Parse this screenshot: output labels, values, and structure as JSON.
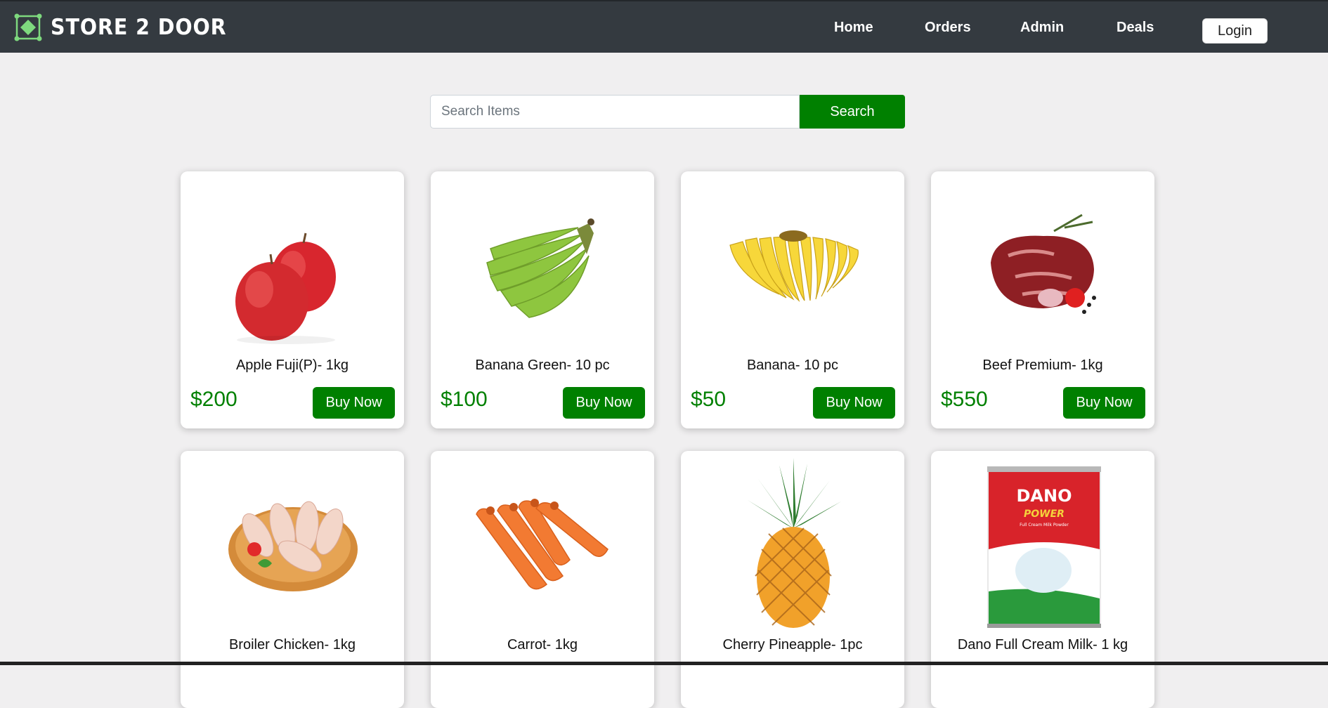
{
  "brand": {
    "name": "STORE 2 DOOR",
    "logo_icon": "diamond-logo-icon",
    "accent": "#7ed97e"
  },
  "nav": {
    "home": "Home",
    "orders": "Orders",
    "admin": "Admin",
    "deals": "Deals",
    "login": "Login"
  },
  "search": {
    "placeholder": "Search Items",
    "value": "",
    "button": "Search"
  },
  "colors": {
    "navbar": "#343a40",
    "primary": "#008000",
    "background": "#f0eff0"
  },
  "products": [
    {
      "name": "Apple Fuji(P)- 1kg",
      "price": "$200",
      "button": "Buy Now",
      "image": "apple"
    },
    {
      "name": "Banana Green- 10 pc",
      "price": "$100",
      "button": "Buy Now",
      "image": "green-banana"
    },
    {
      "name": "Banana- 10 pc",
      "price": "$50",
      "button": "Buy Now",
      "image": "banana"
    },
    {
      "name": "Beef Premium- 1kg",
      "price": "$550",
      "button": "Buy Now",
      "image": "beef"
    },
    {
      "name": "Broiler Chicken- 1kg",
      "price": "",
      "button": "",
      "image": "chicken"
    },
    {
      "name": "Carrot- 1kg",
      "price": "",
      "button": "",
      "image": "carrot"
    },
    {
      "name": "Cherry Pineapple- 1pc",
      "price": "",
      "button": "",
      "image": "pineapple"
    },
    {
      "name": "Dano Full Cream Milk- 1 kg",
      "price": "",
      "button": "",
      "image": "milk-pack",
      "pack_brand": "DANO",
      "pack_sub": "POWER",
      "pack_desc": "Full Cream Milk Powder"
    }
  ]
}
